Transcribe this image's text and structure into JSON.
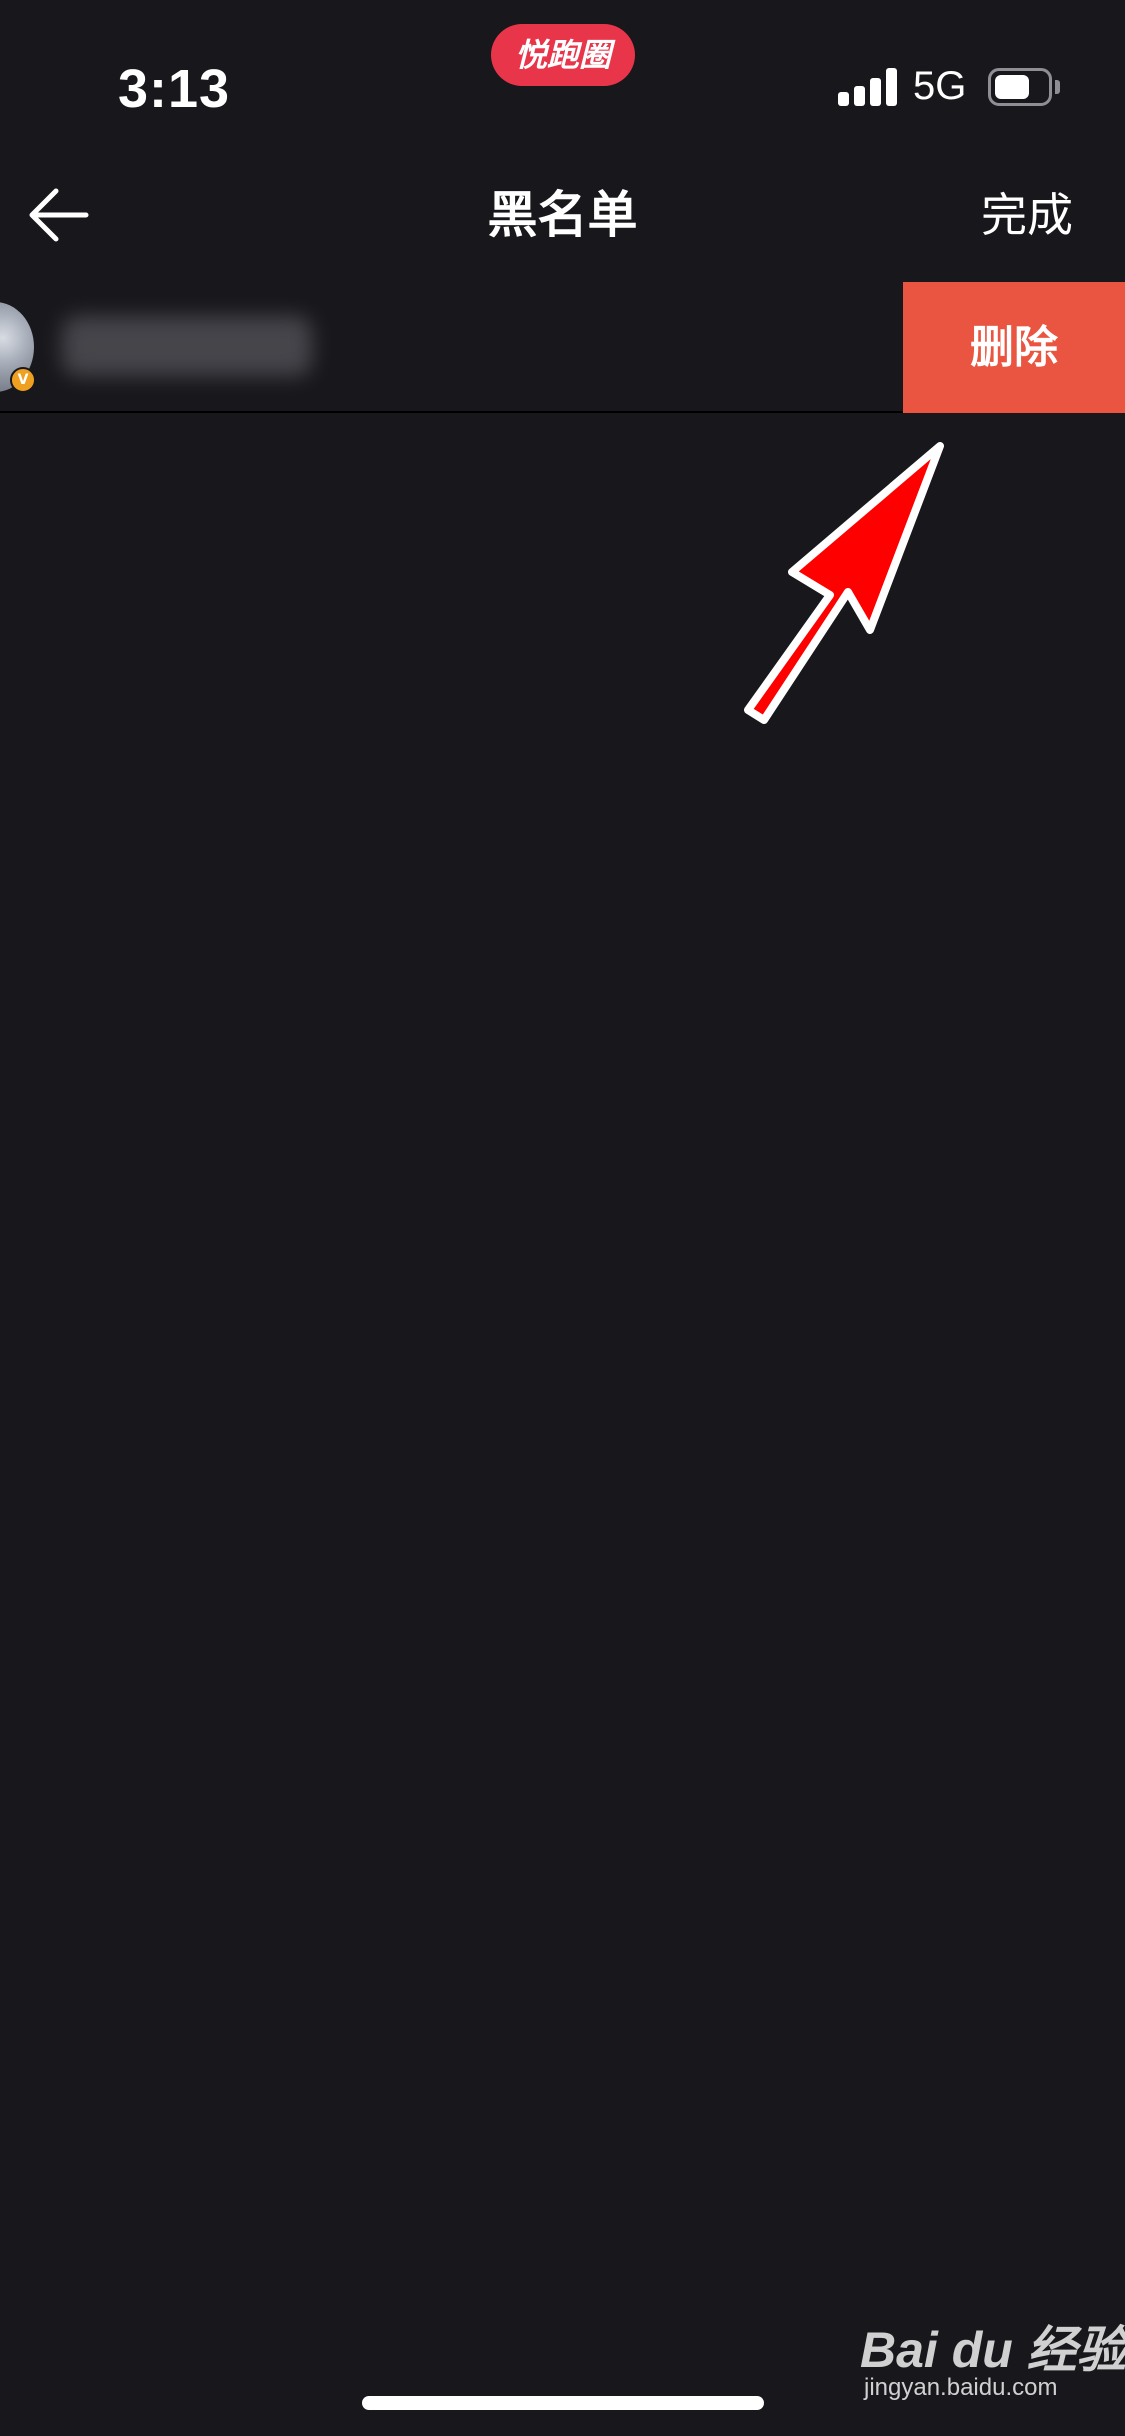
{
  "status_bar": {
    "time": "3:13",
    "app_pill": "悦跑圈",
    "network": "5G",
    "battery_level": 0.65,
    "signal_bars": 4
  },
  "nav": {
    "title": "黑名单",
    "done_label": "完成",
    "back_icon": "arrow-left-icon"
  },
  "blacklist": {
    "items": [
      {
        "username": "",
        "badge": "V",
        "delete_label": "删除"
      }
    ]
  },
  "watermark": {
    "logo": "Bai du 经验",
    "url": "jingyan.baidu.com"
  },
  "colors": {
    "background": "#18181c",
    "delete": "#e95540",
    "accent_pill": "#e8354a",
    "annotation_arrow": "#ff0000"
  }
}
